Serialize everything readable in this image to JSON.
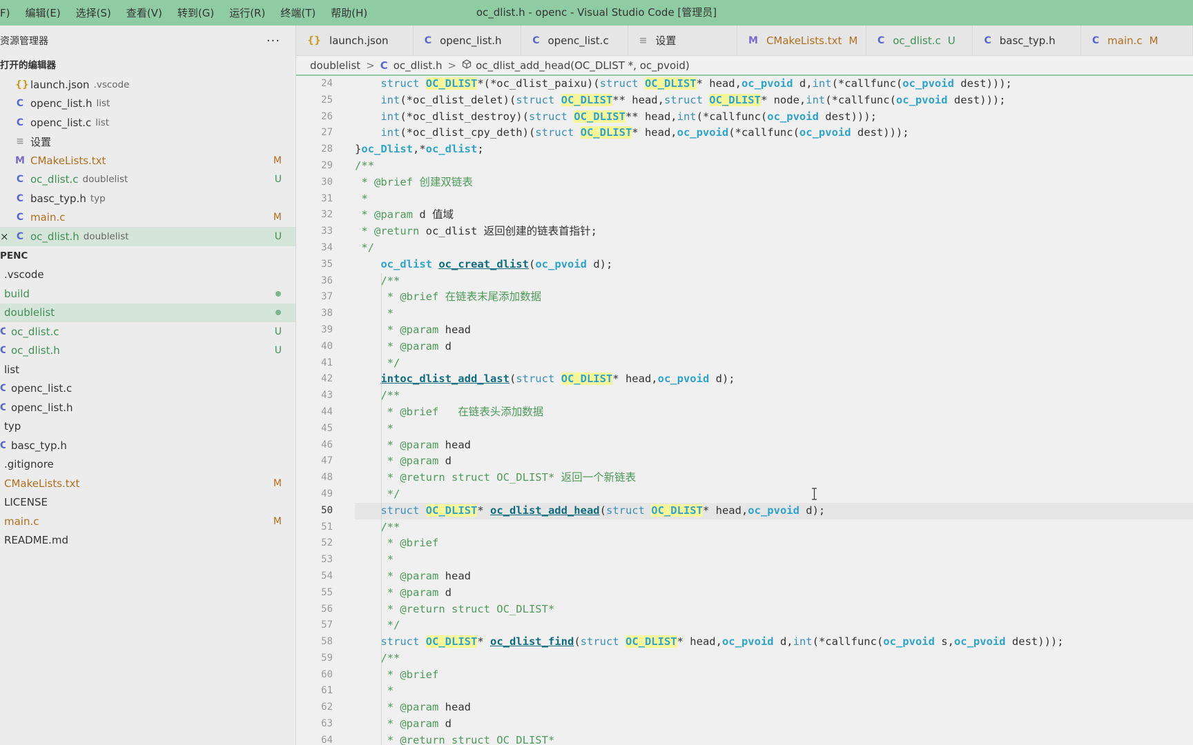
{
  "titlebar": {
    "menu": [
      "F)",
      "编辑(E)",
      "选择(S)",
      "查看(V)",
      "转到(G)",
      "运行(R)",
      "终端(T)",
      "帮助(H)"
    ],
    "title": "oc_dlist.h - openc - Visual Studio Code [管理员]"
  },
  "sidebar": {
    "header": "资源管理器",
    "more": "···",
    "open_editors_title": "打开的编辑器",
    "open_editors": [
      {
        "icon": "{}",
        "name": "launch.json",
        "hint": ".vscode",
        "badge": "",
        "color": "normal"
      },
      {
        "icon": "C",
        "name": "openc_list.h",
        "hint": "list",
        "badge": "",
        "color": "normal"
      },
      {
        "icon": "C",
        "name": "openc_list.c",
        "hint": "list",
        "badge": "",
        "color": "normal"
      },
      {
        "icon": "≡",
        "name": "设置",
        "hint": "",
        "badge": "",
        "color": "normal"
      },
      {
        "icon": "M",
        "name": "CMakeLists.txt",
        "hint": "",
        "badge": "M",
        "color": "orange"
      },
      {
        "icon": "C",
        "name": "oc_dlist.c",
        "hint": "doublelist",
        "badge": "U",
        "color": "green"
      },
      {
        "icon": "C",
        "name": "basc_typ.h",
        "hint": "typ",
        "badge": "",
        "color": "normal"
      },
      {
        "icon": "C",
        "name": "main.c",
        "hint": "",
        "badge": "M",
        "color": "orange"
      },
      {
        "icon": "C",
        "name": "oc_dlist.h",
        "hint": "doublelist",
        "badge": "U",
        "color": "green"
      }
    ],
    "close_mark": "×",
    "project_title": "PENC",
    "tree": [
      {
        "name": ".vscode",
        "icon": "",
        "badge": "",
        "color": "normal"
      },
      {
        "name": "build",
        "icon": "",
        "badge": "dot",
        "color": "green"
      },
      {
        "name": "doublelist",
        "icon": "",
        "badge": "dot",
        "color": "green"
      },
      {
        "name": "oc_dlist.c",
        "icon": "C",
        "badge": "U",
        "color": "green"
      },
      {
        "name": "oc_dlist.h",
        "icon": "C",
        "badge": "U",
        "color": "green"
      },
      {
        "name": "list",
        "icon": "",
        "badge": "",
        "color": "normal"
      },
      {
        "name": "openc_list.c",
        "icon": "C",
        "badge": "",
        "color": "normal"
      },
      {
        "name": "openc_list.h",
        "icon": "C",
        "badge": "",
        "color": "normal"
      },
      {
        "name": "typ",
        "icon": "",
        "badge": "",
        "color": "normal"
      },
      {
        "name": "basc_typ.h",
        "icon": "C",
        "badge": "",
        "color": "normal"
      },
      {
        "name": ".gitignore",
        "icon": "",
        "badge": "",
        "color": "normal"
      },
      {
        "name": "CMakeLists.txt",
        "icon": "",
        "badge": "M",
        "color": "orange"
      },
      {
        "name": "LICENSE",
        "icon": "",
        "badge": "",
        "color": "normal"
      },
      {
        "name": "main.c",
        "icon": "",
        "badge": "M",
        "color": "orange"
      },
      {
        "name": "README.md",
        "icon": "",
        "badge": "",
        "color": "normal"
      }
    ]
  },
  "tabs": [
    {
      "icon": "{}",
      "label": "launch.json",
      "status": ""
    },
    {
      "icon": "C",
      "label": "openc_list.h",
      "status": ""
    },
    {
      "icon": "C",
      "label": "openc_list.c",
      "status": ""
    },
    {
      "icon": "≡",
      "label": "设置",
      "status": ""
    },
    {
      "icon": "M",
      "label": "CMakeLists.txt",
      "status": "M"
    },
    {
      "icon": "C",
      "label": "oc_dlist.c",
      "status": "U"
    },
    {
      "icon": "C",
      "label": "basc_typ.h",
      "status": ""
    },
    {
      "icon": "C",
      "label": "main.c",
      "status": "M"
    }
  ],
  "breadcrumb": {
    "folder": "doublelist",
    "sep": ">",
    "file_icon": "C",
    "file": "oc_dlist.h",
    "symbol": "oc_dlist_add_head(OC_DLIST *, oc_pvoid)"
  },
  "editor": {
    "current_line": 50,
    "lines": [
      {
        "n": 24,
        "segs": [
          [
            "    ",
            ""
          ],
          [
            "struct ",
            "k"
          ],
          [
            "OC_DLIST",
            "hl"
          ],
          [
            "*(*oc_dlist_paixu)(",
            ""
          ],
          [
            "struct ",
            "k"
          ],
          [
            "OC_DLIST",
            "hl"
          ],
          [
            "* head,",
            ""
          ],
          [
            "oc_pvoid",
            "t"
          ],
          [
            " d,",
            ""
          ],
          [
            "int",
            "k"
          ],
          [
            "(*callfunc(",
            ""
          ],
          [
            "oc_pvoid",
            "t"
          ],
          [
            " dest)));",
            ""
          ]
        ]
      },
      {
        "n": 25,
        "segs": [
          [
            "    ",
            ""
          ],
          [
            "int",
            "k"
          ],
          [
            "(*oc_dlist_delet)(",
            ""
          ],
          [
            "struct ",
            "k"
          ],
          [
            "OC_DLIST",
            "hl"
          ],
          [
            "** head,",
            ""
          ],
          [
            "struct ",
            "k"
          ],
          [
            "OC_DLIST",
            "hl"
          ],
          [
            "* node,",
            ""
          ],
          [
            "int",
            "k"
          ],
          [
            "(*callfunc(",
            ""
          ],
          [
            "oc_pvoid",
            "t"
          ],
          [
            " dest)));",
            ""
          ]
        ]
      },
      {
        "n": 26,
        "segs": [
          [
            "    ",
            ""
          ],
          [
            "int",
            "k"
          ],
          [
            "(*oc_dlist_destroy)(",
            ""
          ],
          [
            "struct ",
            "k"
          ],
          [
            "OC_DLIST",
            "hl"
          ],
          [
            "** head,",
            ""
          ],
          [
            "int",
            "k"
          ],
          [
            "(*callfunc(",
            ""
          ],
          [
            "oc_pvoid",
            "t"
          ],
          [
            " dest)));",
            ""
          ]
        ]
      },
      {
        "n": 27,
        "segs": [
          [
            "    ",
            ""
          ],
          [
            "int",
            "k"
          ],
          [
            "(*oc_dlist_cpy_deth)(",
            ""
          ],
          [
            "struct ",
            "k"
          ],
          [
            "OC_DLIST",
            "hl"
          ],
          [
            "* head,",
            ""
          ],
          [
            "oc_pvoid",
            "t"
          ],
          [
            "(*callfunc(",
            ""
          ],
          [
            "oc_pvoid",
            "t"
          ],
          [
            " dest)));",
            ""
          ]
        ]
      },
      {
        "n": 28,
        "segs": [
          [
            "}",
            ""
          ],
          [
            "oc_Dlist",
            "t"
          ],
          [
            ",*",
            ""
          ],
          [
            "oc_dlist",
            "t"
          ],
          [
            ";",
            ""
          ]
        ]
      },
      {
        "n": 29,
        "segs": [
          [
            "/**",
            "cm"
          ]
        ]
      },
      {
        "n": 30,
        "segs": [
          [
            " * @brief 创建双链表",
            "cm"
          ]
        ]
      },
      {
        "n": 31,
        "segs": [
          [
            " *",
            "cm"
          ]
        ]
      },
      {
        "n": 32,
        "segs": [
          [
            " * @param ",
            "cm"
          ],
          [
            "d 值域",
            "cmt"
          ]
        ]
      },
      {
        "n": 33,
        "segs": [
          [
            " * @return ",
            "cm"
          ],
          [
            "oc_dlist 返回创建的链表首指针;",
            "cmt"
          ]
        ]
      },
      {
        "n": 34,
        "segs": [
          [
            " */",
            "cm"
          ]
        ]
      },
      {
        "n": 35,
        "segs": [
          [
            "    ",
            ""
          ],
          [
            "oc_dlist",
            "t"
          ],
          [
            " ",
            ""
          ],
          [
            "oc_creat_dlist",
            "fn"
          ],
          [
            "(",
            ""
          ],
          [
            "oc_pvoid",
            "t"
          ],
          [
            " d);",
            ""
          ]
        ]
      },
      {
        "n": 36,
        "segs": [
          [
            "    /**",
            "cm"
          ]
        ]
      },
      {
        "n": 37,
        "segs": [
          [
            "     * @brief 在链表末尾添加数据",
            "cm"
          ]
        ]
      },
      {
        "n": 38,
        "segs": [
          [
            "     *",
            "cm"
          ]
        ]
      },
      {
        "n": 39,
        "segs": [
          [
            "     * @param ",
            "cm"
          ],
          [
            "head",
            "cmt"
          ]
        ]
      },
      {
        "n": 40,
        "segs": [
          [
            "     * @param ",
            "cm"
          ],
          [
            "d",
            "cmt"
          ]
        ]
      },
      {
        "n": 41,
        "segs": [
          [
            "     */",
            "cm"
          ]
        ]
      },
      {
        "n": 42,
        "segs": [
          [
            "    ",
            ""
          ],
          [
            "intoc_dlist_add_last",
            "fn"
          ],
          [
            "(",
            ""
          ],
          [
            "struct ",
            "k"
          ],
          [
            "OC_DLIST",
            "hl"
          ],
          [
            "* head,",
            ""
          ],
          [
            "oc_pvoid",
            "t"
          ],
          [
            " d);",
            ""
          ]
        ]
      },
      {
        "n": 43,
        "segs": [
          [
            "    /**",
            "cm"
          ]
        ]
      },
      {
        "n": 44,
        "segs": [
          [
            "     * @brief   在链表头添加数据",
            "cm"
          ]
        ]
      },
      {
        "n": 45,
        "segs": [
          [
            "     *",
            "cm"
          ]
        ]
      },
      {
        "n": 46,
        "segs": [
          [
            "     * @param ",
            "cm"
          ],
          [
            "head",
            "cmt"
          ]
        ]
      },
      {
        "n": 47,
        "segs": [
          [
            "     * @param ",
            "cm"
          ],
          [
            "d",
            "cmt"
          ]
        ]
      },
      {
        "n": 48,
        "segs": [
          [
            "     * @return ",
            "cm"
          ],
          [
            "struct OC_DLIST* 返回一个新链表",
            "cm"
          ]
        ]
      },
      {
        "n": 49,
        "segs": [
          [
            "     */",
            "cm"
          ]
        ]
      },
      {
        "n": 50,
        "segs": [
          [
            "    ",
            ""
          ],
          [
            "struct ",
            "k"
          ],
          [
            "OC_DLIST",
            "hl"
          ],
          [
            "* ",
            ""
          ],
          [
            "oc_dlist_add_head",
            "fn"
          ],
          [
            "(",
            ""
          ],
          [
            "struct ",
            "k"
          ],
          [
            "OC_DLIST",
            "hl"
          ],
          [
            "* head,",
            ""
          ],
          [
            "oc_pvoid",
            "t"
          ],
          [
            " d);",
            ""
          ]
        ]
      },
      {
        "n": 51,
        "segs": [
          [
            "    /**",
            "cm"
          ]
        ]
      },
      {
        "n": 52,
        "segs": [
          [
            "     * @brief",
            "cm"
          ]
        ]
      },
      {
        "n": 53,
        "segs": [
          [
            "     *",
            "cm"
          ]
        ]
      },
      {
        "n": 54,
        "segs": [
          [
            "     * @param ",
            "cm"
          ],
          [
            "head",
            "cmt"
          ]
        ]
      },
      {
        "n": 55,
        "segs": [
          [
            "     * @param ",
            "cm"
          ],
          [
            "d",
            "cmt"
          ]
        ]
      },
      {
        "n": 56,
        "segs": [
          [
            "     * @return ",
            "cm"
          ],
          [
            "struct OC_DLIST*",
            "cm"
          ]
        ]
      },
      {
        "n": 57,
        "segs": [
          [
            "     */",
            "cm"
          ]
        ]
      },
      {
        "n": 58,
        "segs": [
          [
            "    ",
            ""
          ],
          [
            "struct ",
            "k"
          ],
          [
            "OC_DLIST",
            "hl"
          ],
          [
            "* ",
            ""
          ],
          [
            "oc_dlist_find",
            "fn"
          ],
          [
            "(",
            ""
          ],
          [
            "struct ",
            "k"
          ],
          [
            "OC_DLIST",
            "hl"
          ],
          [
            "* head,",
            ""
          ],
          [
            "oc_pvoid",
            "t"
          ],
          [
            " d,",
            ""
          ],
          [
            "int",
            "k"
          ],
          [
            "(*callfunc(",
            ""
          ],
          [
            "oc_pvoid",
            "t"
          ],
          [
            " s,",
            ""
          ],
          [
            "oc_pvoid",
            "t"
          ],
          [
            " dest)));",
            ""
          ]
        ]
      },
      {
        "n": 59,
        "segs": [
          [
            "    /**",
            "cm"
          ]
        ]
      },
      {
        "n": 60,
        "segs": [
          [
            "     * @brief",
            "cm"
          ]
        ]
      },
      {
        "n": 61,
        "segs": [
          [
            "     *",
            "cm"
          ]
        ]
      },
      {
        "n": 62,
        "segs": [
          [
            "     * @param ",
            "cm"
          ],
          [
            "head",
            "cmt"
          ]
        ]
      },
      {
        "n": 63,
        "segs": [
          [
            "     * @param ",
            "cm"
          ],
          [
            "d",
            "cmt"
          ]
        ]
      },
      {
        "n": 64,
        "segs": [
          [
            "     * @return ",
            "cm"
          ],
          [
            "struct OC_DLIST*",
            "cm"
          ]
        ]
      }
    ]
  }
}
